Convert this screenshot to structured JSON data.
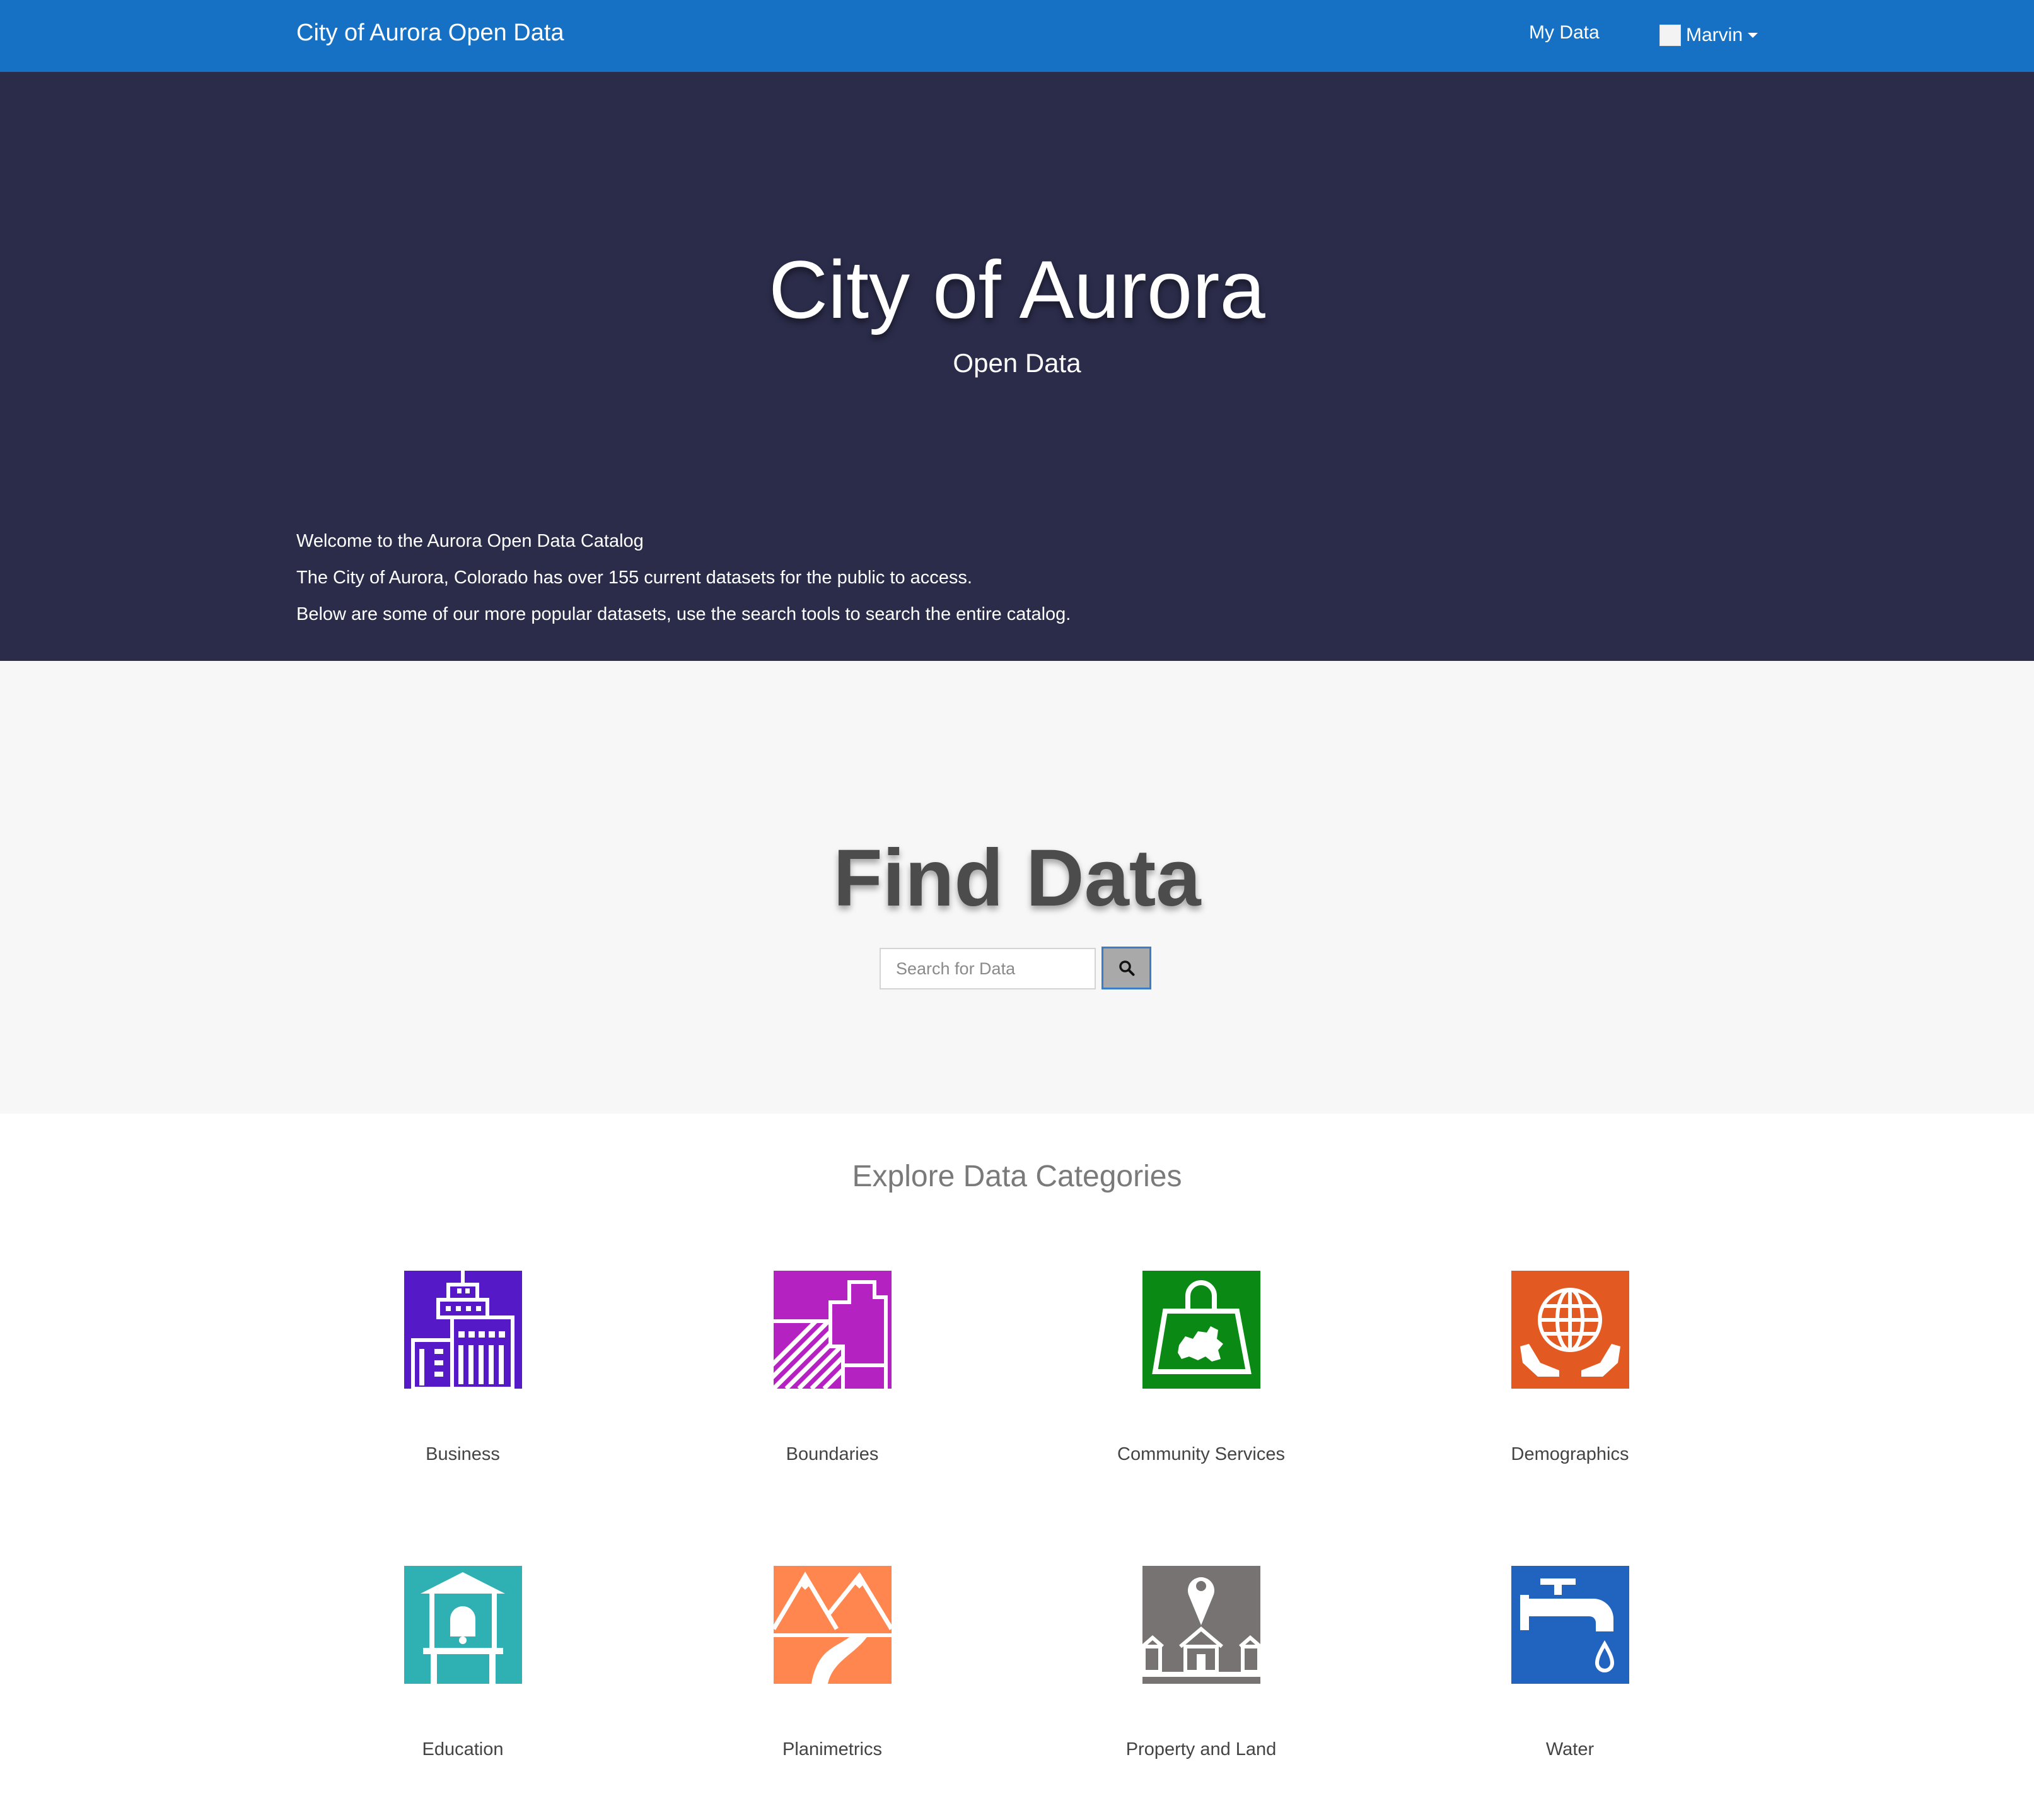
{
  "nav": {
    "brand": "City of Aurora Open Data",
    "my_data": "My Data",
    "user_name": "Marvin"
  },
  "hero": {
    "title": "City of Aurora",
    "subtitle": "Open Data",
    "lines": [
      "Welcome to the Aurora Open Data Catalog",
      "The City of Aurora, Colorado has over 155 current datasets for the public to access.",
      "Below are some of our more popular datasets, use the search tools to search the entire catalog."
    ]
  },
  "find": {
    "title": "Find Data",
    "search_placeholder": "Search for Data"
  },
  "categories": {
    "title": "Explore Data Categories",
    "items": [
      {
        "label": "Business",
        "icon": "building-icon",
        "color": "#5519c8"
      },
      {
        "label": "Boundaries",
        "icon": "boundaries-icon",
        "color": "#b422c2"
      },
      {
        "label": "Community Services",
        "icon": "shopping-bag-icon",
        "color": "#0a8a14"
      },
      {
        "label": "Demographics",
        "icon": "globe-hands-icon",
        "color": "#e25a22"
      },
      {
        "label": "Education",
        "icon": "school-bell-icon",
        "color": "#2fb0b3"
      },
      {
        "label": "Planimetrics",
        "icon": "mountains-road-icon",
        "color": "#ff864e"
      },
      {
        "label": "Property and Land",
        "icon": "houses-pin-icon",
        "color": "#787373"
      },
      {
        "label": "Water",
        "icon": "faucet-icon",
        "color": "#2164bf"
      }
    ]
  }
}
